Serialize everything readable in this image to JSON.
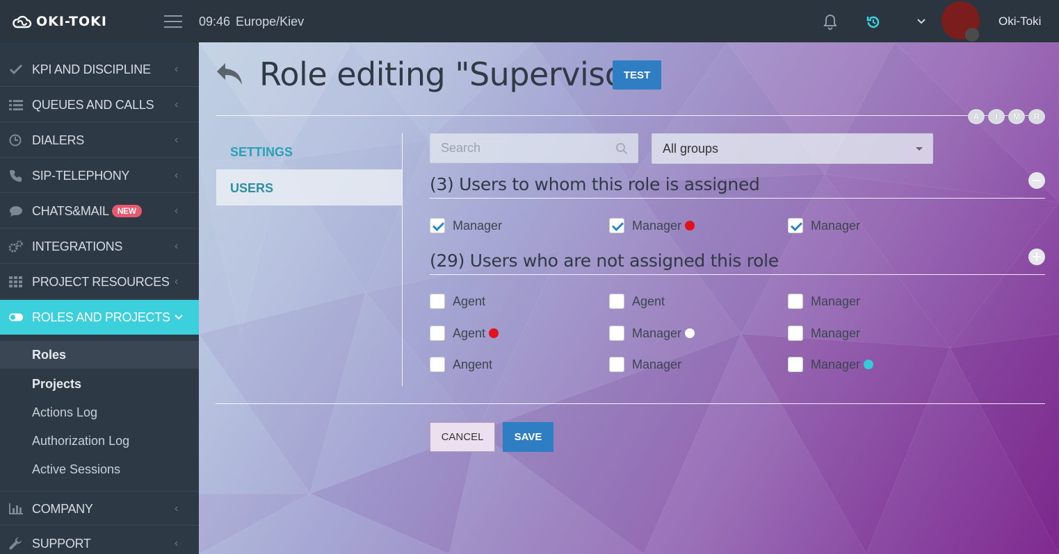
{
  "app": {
    "logo": "OKI-TOKI"
  },
  "header": {
    "time": "09:46",
    "timezone": "Europe/Kiev",
    "username": "Oki-Toki",
    "icons": [
      "menu-icon",
      "bell-icon",
      "sync-icon",
      "chevron-down-icon"
    ]
  },
  "sidebar": {
    "items": [
      {
        "label": "KPI AND DISCIPLINE",
        "icon": "check-icon"
      },
      {
        "label": "QUEUES AND CALLS",
        "icon": "list-icon"
      },
      {
        "label": "DIALERS",
        "icon": "clock-icon"
      },
      {
        "label": "SIP-TELEPHONY",
        "icon": "phone-icon"
      },
      {
        "label": "CHATS&MAIL",
        "icon": "chat-icon",
        "badge": "NEW"
      },
      {
        "label": "INTEGRATIONS",
        "icon": "gears-icon"
      },
      {
        "label": "PROJECT RESOURCES",
        "icon": "grid-icon"
      },
      {
        "label": "ROLES AND PROJECTS",
        "icon": "toggle-icon",
        "active": true
      },
      {
        "label": "COMPANY",
        "icon": "bar-chart-icon"
      },
      {
        "label": "SUPPORT",
        "icon": "wrench-icon"
      }
    ],
    "subitems": [
      "Roles",
      "Projects",
      "Actions Log",
      "Authorization Log",
      "Active Sessions"
    ]
  },
  "page": {
    "title": "Role editing \"Supervisor\"",
    "test_button": "TEST",
    "aimr": [
      "A",
      "I",
      "M",
      "R"
    ],
    "tabs": [
      "SETTINGS",
      "USERS"
    ],
    "active_tab": "USERS"
  },
  "filters": {
    "search_placeholder": "Search",
    "group_select": "All groups"
  },
  "assigned": {
    "title": "(3) Users to whom this role is assigned",
    "users": [
      {
        "name": "Manager",
        "checked": true
      },
      {
        "name": "Manager",
        "checked": true,
        "status_color": "#e0121b"
      },
      {
        "name": "Manager",
        "checked": true
      }
    ]
  },
  "unassigned": {
    "title": "(29) Users who are not assigned this role",
    "users": [
      {
        "name": "Agent",
        "checked": false
      },
      {
        "name": "Agent",
        "checked": false
      },
      {
        "name": "Manager",
        "checked": false
      },
      {
        "name": "Agent",
        "checked": false,
        "status_color": "#e0121b"
      },
      {
        "name": "Manager",
        "checked": false,
        "status_color": "#ffffff"
      },
      {
        "name": "Manager",
        "checked": false
      },
      {
        "name": "Angent",
        "checked": false
      },
      {
        "name": "Manager",
        "checked": false
      },
      {
        "name": "Manager",
        "checked": false,
        "status_color": "#34ccd6"
      }
    ]
  },
  "actions": {
    "cancel": "CANCEL",
    "save": "SAVE"
  },
  "colors": {
    "accent": "#3ccfdc",
    "primary": "#2f7ec4",
    "sidebar": "#2e3946"
  }
}
